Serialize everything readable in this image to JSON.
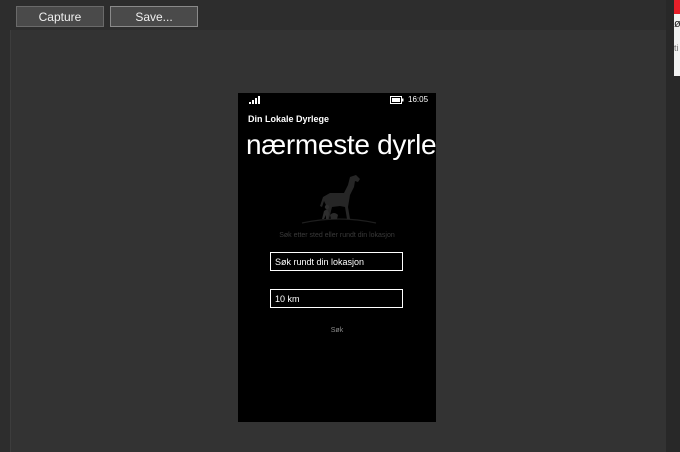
{
  "toolbar": {
    "capture_label": "Capture",
    "save_label": "Save..."
  },
  "phone": {
    "status_time": "16:05",
    "app_title": "Din Lokale Dyrlege",
    "page_title": "nærmeste dyrle",
    "hint": "Søk etter sted eller rundt din lokasjon",
    "search_field_value": "Søk rundt din lokasjon",
    "distance_field_value": "10 km",
    "search_button_label": "Søk"
  },
  "side_peek": {
    "char1": "ø",
    "char2": "ti"
  },
  "colors": {
    "background": "#2d2d2d",
    "phone_screen": "#000000",
    "accent_red": "#e8202a"
  }
}
